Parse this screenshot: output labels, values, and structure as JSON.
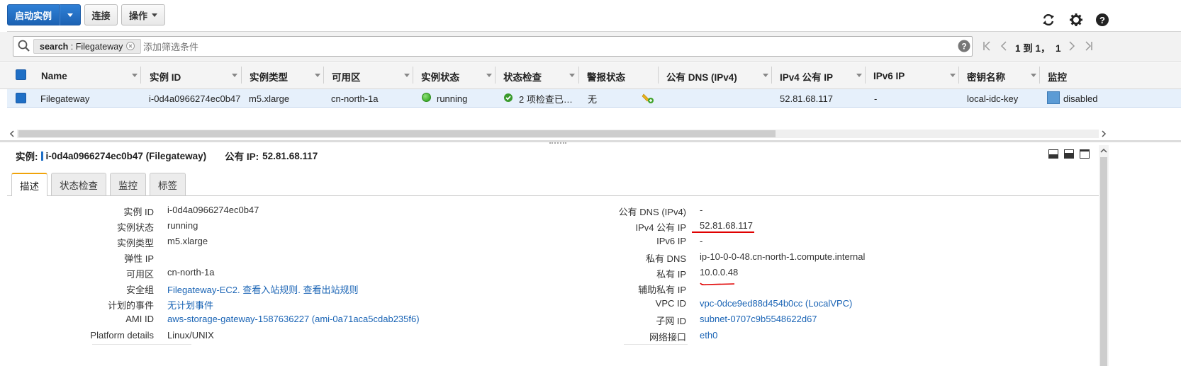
{
  "toolbar": {
    "launch_label": "启动实例",
    "connect_label": "连接",
    "actions_label": "操作"
  },
  "filter": {
    "token_key": "search",
    "token_value": "Filegateway",
    "placeholder": "添加筛选条件",
    "pagination": "1 到 1，  1"
  },
  "table": {
    "headers": [
      "Name",
      "实例 ID",
      "实例类型",
      "可用区",
      "实例状态",
      "状态检查",
      "警报状态",
      "公有 DNS (IPv4)",
      "IPv4 公有 IP",
      "IPv6 IP",
      "密钥名称",
      "监控"
    ],
    "row": {
      "name": "Filegateway",
      "instance_id": "i-0d4a0966274ec0b47",
      "type": "m5.xlarge",
      "az": "cn-north-1a",
      "state": "running",
      "checks": "2 项检查已…",
      "alarm": "无",
      "dns": "",
      "ipv4": "52.81.68.117",
      "ipv6": "-",
      "key": "local-idc-key",
      "monitoring": "disabled"
    }
  },
  "detail": {
    "title_label": "实例:",
    "title_value": "i-0d4a0966274ec0b47 (Filegateway)",
    "public_ip_label": "公有 IP:",
    "public_ip_value": "52.81.68.117",
    "tabs": [
      "描述",
      "状态检查",
      "监控",
      "标签"
    ],
    "left": [
      {
        "label": "实例 ID",
        "value": "i-0d4a0966274ec0b47"
      },
      {
        "label": "实例状态",
        "value": "running"
      },
      {
        "label": "实例类型",
        "value": "m5.xlarge"
      },
      {
        "label": "弹性 IP",
        "value": ""
      },
      {
        "label": "可用区",
        "value": "cn-north-1a"
      },
      {
        "label": "安全组",
        "value": "Filegateway-EC2.",
        "link2": "查看入站规则.",
        "link3": "查看出站规则"
      },
      {
        "label": "计划的事件",
        "value": "无计划事件"
      },
      {
        "label": "AMI ID",
        "value": "aws-storage-gateway-1587636227 (ami-0a71aca5cdab235f6)"
      },
      {
        "label": "Platform details",
        "value": "Linux/UNIX"
      }
    ],
    "right": [
      {
        "label": "公有 DNS (IPv4)",
        "value": "-"
      },
      {
        "label": "IPv4 公有 IP",
        "value": "52.81.68.117"
      },
      {
        "label": "IPv6 IP",
        "value": "-"
      },
      {
        "label": "私有 DNS",
        "value": "ip-10-0-0-48.cn-north-1.compute.internal"
      },
      {
        "label": "私有 IP",
        "value": "10.0.0.48"
      },
      {
        "label": "辅助私有 IP",
        "value": ""
      },
      {
        "label": "VPC ID",
        "value": "vpc-0dce9ed88d454b0cc (LocalVPC)"
      },
      {
        "label": "子网 ID",
        "value": "subnet-0707c9b5548622d67"
      },
      {
        "label": "网络接口",
        "value": "eth0"
      }
    ]
  },
  "colors": {
    "primary": "#1f6fc5",
    "running": "#3fb02b",
    "annotation": "#e00000",
    "link": "#1a64b5"
  }
}
